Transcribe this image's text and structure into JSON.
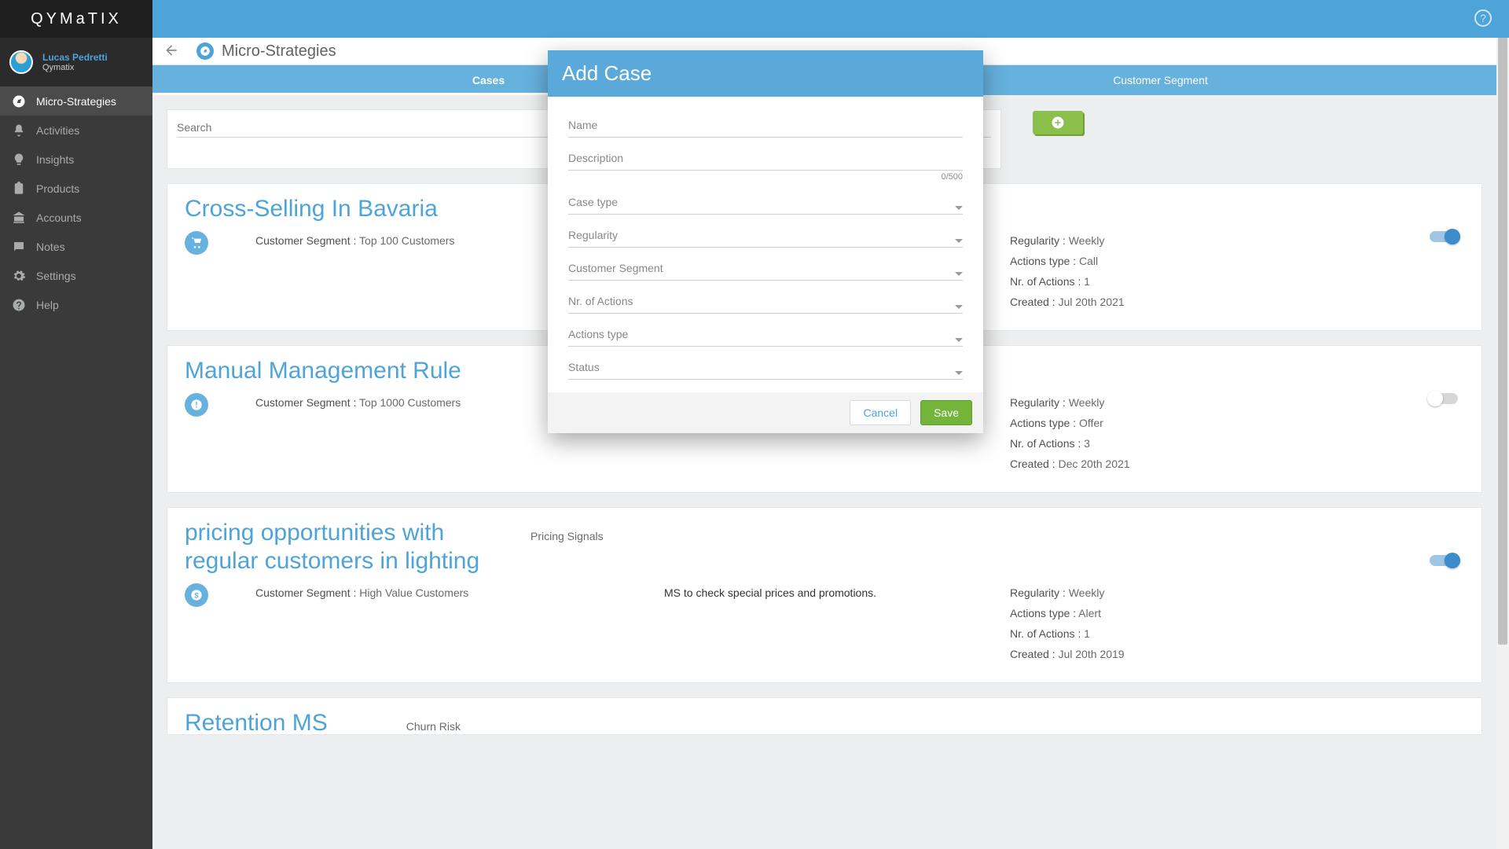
{
  "brand": "QYMaTIX",
  "user": {
    "name": "Lucas Pedretti",
    "company": "Qymatix"
  },
  "sidebar": {
    "items": [
      {
        "label": "Micro-Strategies",
        "slug": "micro-strategies",
        "active": true
      },
      {
        "label": "Activities",
        "slug": "activities",
        "active": false
      },
      {
        "label": "Insights",
        "slug": "insights",
        "active": false
      },
      {
        "label": "Products",
        "slug": "products",
        "active": false
      },
      {
        "label": "Accounts",
        "slug": "accounts",
        "active": false
      },
      {
        "label": "Notes",
        "slug": "notes",
        "active": false
      },
      {
        "label": "Settings",
        "slug": "settings",
        "active": false
      },
      {
        "label": "Help",
        "slug": "help",
        "active": false
      }
    ]
  },
  "page": {
    "title": "Micro-Strategies"
  },
  "tabs": [
    {
      "label": "Cases",
      "active": true
    },
    {
      "label": "Customer Segment",
      "active": false
    }
  ],
  "search": {
    "placeholder": "Search"
  },
  "labels": {
    "segment": "Customer Segment :",
    "regularity": "Regularity :",
    "actions_type": "Actions type :",
    "nr_actions": "Nr. of Actions :",
    "created": "Created :"
  },
  "modal": {
    "title": "Add Case",
    "fields": {
      "name": "Name",
      "description": "Description",
      "desc_counter": "0/500",
      "case_type": "Case type",
      "regularity": "Regularity",
      "segment": "Customer Segment",
      "nr_actions": "Nr. of Actions",
      "actions_type": "Actions type",
      "status": "Status"
    },
    "cancel": "Cancel",
    "save": "Save"
  },
  "cases": [
    {
      "title": "Cross-Selling In Bavaria",
      "icon": "cart",
      "segment": "Top 100 Customers",
      "tag": "",
      "regularity": "Weekly",
      "actions_type": "Call",
      "nr_actions": "1",
      "created": "Jul 20th 2021",
      "toggle": "on"
    },
    {
      "title": "Manual Management Rule",
      "icon": "alert",
      "segment": "Top 1000 Customers",
      "tag": "",
      "regularity": "Weekly",
      "actions_type": "Offer",
      "nr_actions": "3",
      "created": "Dec 20th 2021",
      "toggle": "off"
    },
    {
      "title": "pricing opportunities with regular customers in lighting",
      "icon": "dollar",
      "segment": "High Value Customers",
      "tag": "Pricing Signals",
      "description": "MS to check special prices and promotions.",
      "regularity": "Weekly",
      "actions_type": "Alert",
      "nr_actions": "1",
      "created": "Jul 20th 2019",
      "toggle": "on"
    },
    {
      "title": "Retention MS",
      "icon": "",
      "segment": "",
      "tag": "Churn Risk",
      "regularity": "",
      "actions_type": "",
      "nr_actions": "",
      "created": "",
      "toggle": "on",
      "partial": true
    }
  ]
}
